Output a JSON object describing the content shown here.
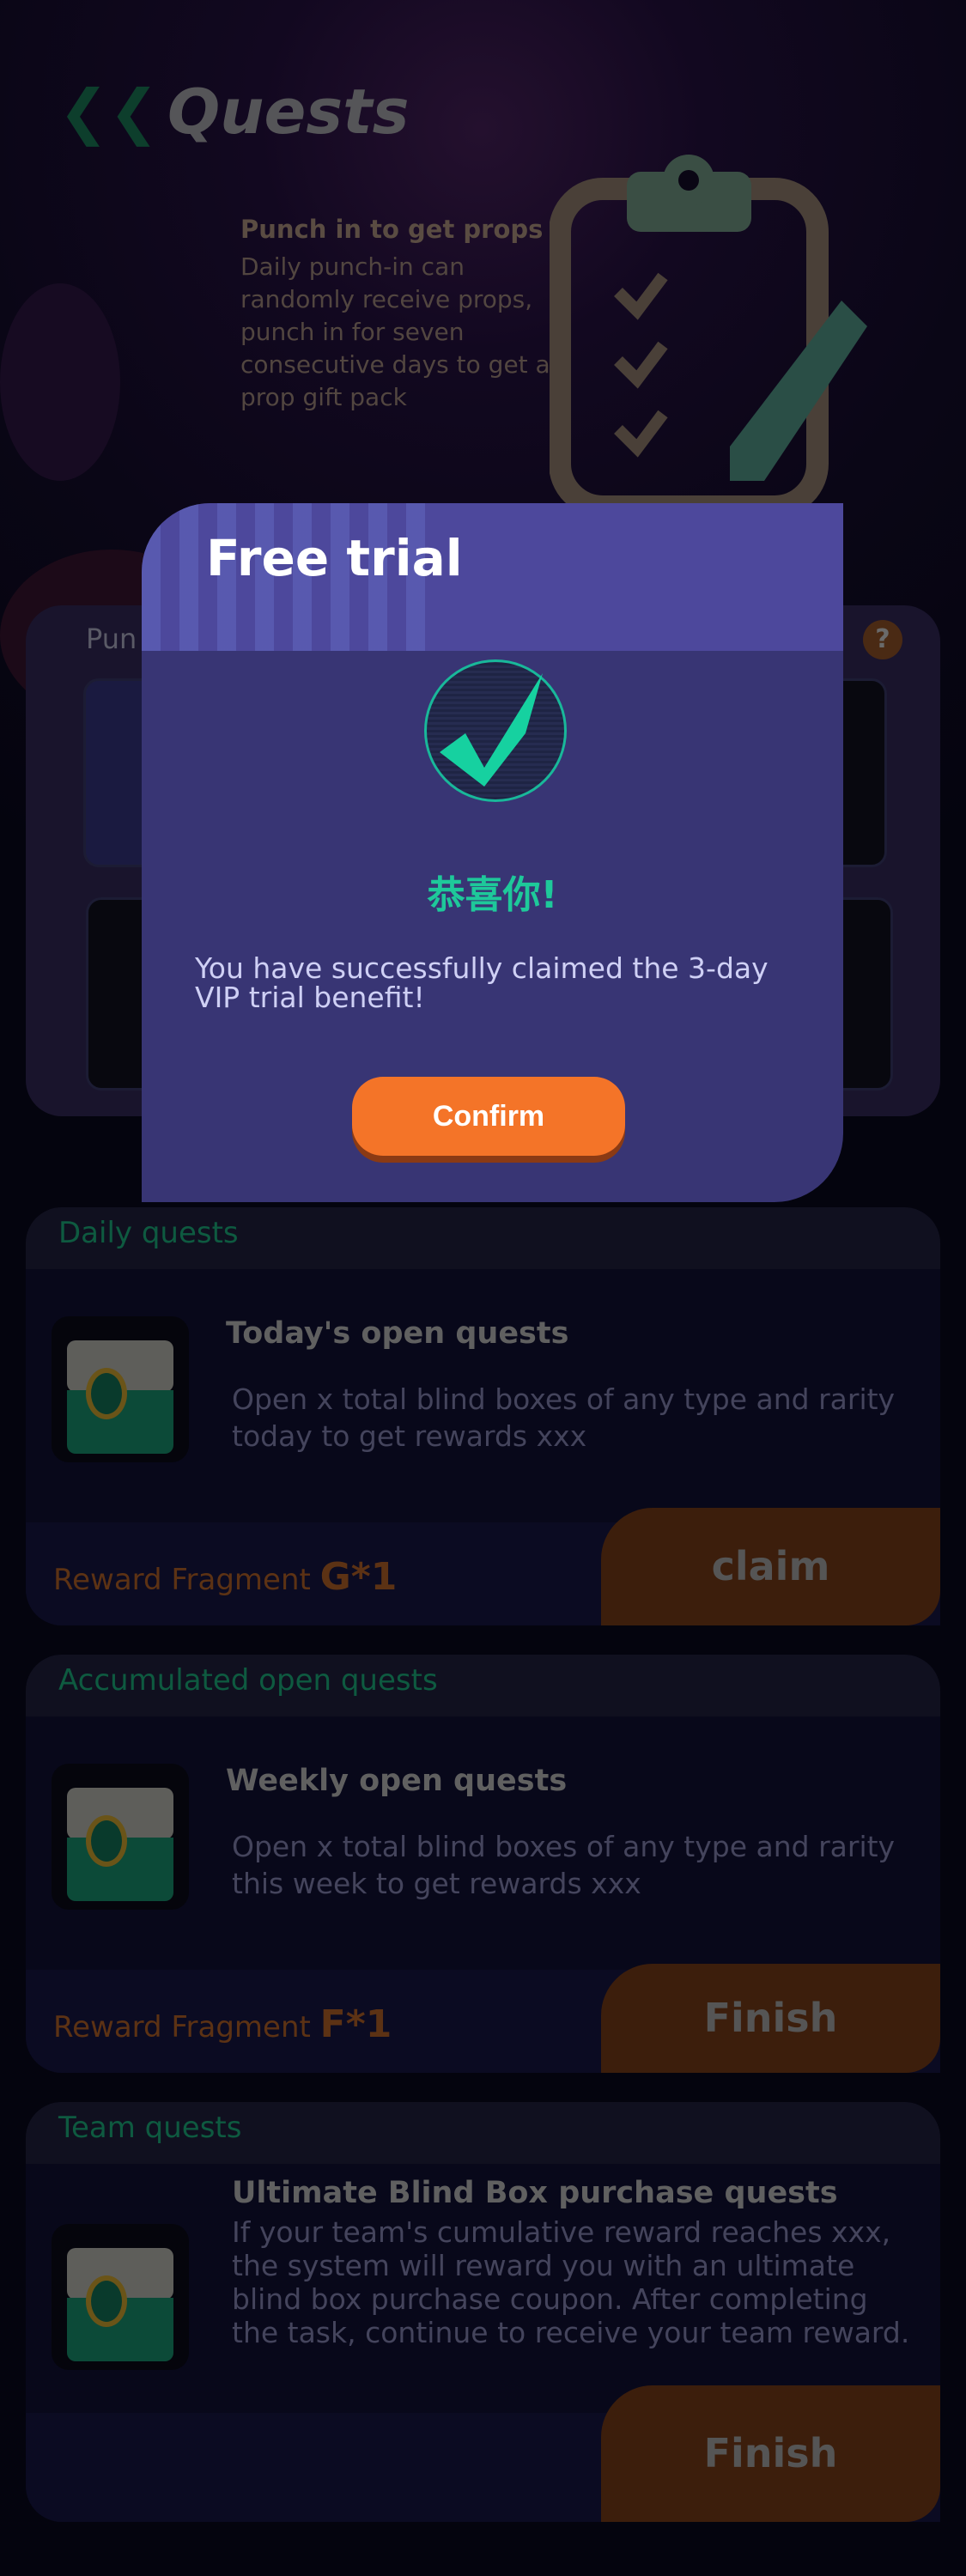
{
  "header": {
    "title": "Quests",
    "back_icon": "double-chevron-left-icon"
  },
  "punch": {
    "title": "Punch in to get props",
    "desc": "Daily punch-in can randomly receive props, punch in for seven consecutive days to get a prop gift pack",
    "panel_label": "Pun",
    "help": "?"
  },
  "quests": [
    {
      "section": "Daily quests",
      "title": "Today's open quests",
      "desc": "Open x total blind boxes of any type and rarity today to get rewards xxx",
      "reward_label": "Reward Fragment",
      "reward_value": "G*1",
      "button": "claim"
    },
    {
      "section": "Accumulated open quests",
      "title": "Weekly open quests",
      "desc": "Open x total blind boxes of any type and rarity this week to get rewards xxx",
      "reward_label": "Reward Fragment",
      "reward_value": "F*1",
      "button": "Finish"
    },
    {
      "section": "Team quests",
      "title": "Ultimate Blind Box purchase quests",
      "desc": "If your team's cumulative reward reaches xxx, the system will reward you with an ultimate blind box purchase coupon. After completing the task, continue to receive your team reward.",
      "button": "Finish"
    }
  ],
  "modal": {
    "title": "Free trial",
    "congrats": "恭喜你!",
    "message": "You have successfully claimed the 3-day VIP trial benefit!",
    "confirm": "Confirm",
    "icon": "check-circle-icon"
  },
  "colors": {
    "accent": "#f47428",
    "success": "#1ec99a",
    "modal_bg": "#383574",
    "modal_header": "#4d489c"
  }
}
